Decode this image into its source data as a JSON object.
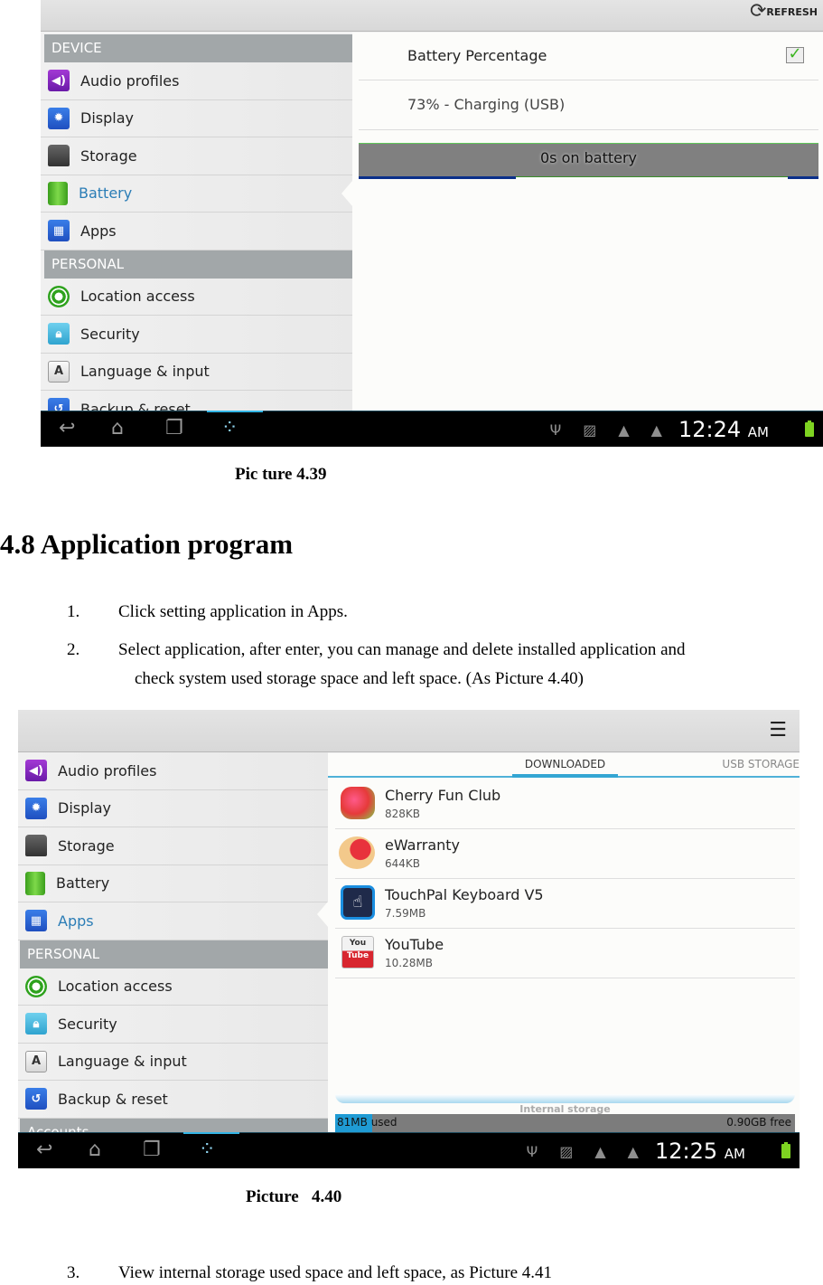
{
  "figure1": {
    "action_bar": {
      "refresh_label": "REFRESH"
    },
    "sidebar": {
      "sections": [
        {
          "header": "DEVICE",
          "items": [
            {
              "label": "Audio profiles",
              "icon": "audio-icon"
            },
            {
              "label": "Display",
              "icon": "display-icon"
            },
            {
              "label": "Storage",
              "icon": "storage-icon"
            },
            {
              "label": "Battery",
              "icon": "battery-icon",
              "active": true
            },
            {
              "label": "Apps",
              "icon": "apps-icon"
            }
          ]
        },
        {
          "header": "PERSONAL",
          "items": [
            {
              "label": "Location access",
              "icon": "location-icon"
            },
            {
              "label": "Security",
              "icon": "lock-icon"
            },
            {
              "label": "Language & input",
              "icon": "language-icon"
            },
            {
              "label": "Backup & reset",
              "icon": "backup-icon"
            }
          ]
        }
      ]
    },
    "detail": {
      "battery_percentage_label": "Battery Percentage",
      "battery_percentage_checked": true,
      "status_text": "73% - Charging (USB)",
      "graph_label": "0s on battery"
    },
    "status_bar": {
      "time": "12:24",
      "ampm": "AM"
    },
    "caption": "Pic ture 4.39"
  },
  "section": {
    "heading": "4.8 Application program",
    "steps": [
      {
        "num": "1.",
        "text": "Click setting application in Apps."
      },
      {
        "num": "2.",
        "text": "Select application, after enter, you can manage and delete installed application and",
        "cont": "check system used storage space and left space. (As Picture 4.40)"
      }
    ]
  },
  "figure2": {
    "sidebar": {
      "items_top": [
        {
          "label": "Audio profiles",
          "icon": "audio-icon"
        },
        {
          "label": "Display",
          "icon": "display-icon"
        },
        {
          "label": "Storage",
          "icon": "storage-icon"
        },
        {
          "label": "Battery",
          "icon": "battery-icon"
        },
        {
          "label": "Apps",
          "icon": "apps-icon",
          "active": true
        }
      ],
      "personal_header": "PERSONAL",
      "items_personal": [
        {
          "label": "Location access",
          "icon": "location-icon"
        },
        {
          "label": "Security",
          "icon": "lock-icon"
        },
        {
          "label": "Language & input",
          "icon": "language-icon"
        },
        {
          "label": "Backup & reset",
          "icon": "backup-icon"
        }
      ],
      "accounts_header": "Accounts"
    },
    "tabs": [
      {
        "label": "DOWNLOADED",
        "selected": true
      },
      {
        "label": "USB STORAGE",
        "selected": false
      }
    ],
    "apps": [
      {
        "name": "Cherry Fun Club",
        "size": "828KB",
        "icon": "cherry-fun-club-icon"
      },
      {
        "name": "eWarranty",
        "size": "644KB",
        "icon": "ewarranty-icon"
      },
      {
        "name": "TouchPal Keyboard V5",
        "size": "7.59MB",
        "icon": "touchpal-icon"
      },
      {
        "name": "YouTube",
        "size": "10.28MB",
        "icon": "youtube-icon"
      }
    ],
    "storage": {
      "label": "Internal storage",
      "used": "81MB",
      "used_suffix": "used",
      "free": "0.90GB free",
      "used_fraction": 0.08
    },
    "status_bar": {
      "time": "12:25",
      "ampm": "AM"
    },
    "caption": "Picture   4.40"
  },
  "step3": {
    "num": "3.",
    "text": "View internal storage used space and left space, as Picture 4.41"
  }
}
